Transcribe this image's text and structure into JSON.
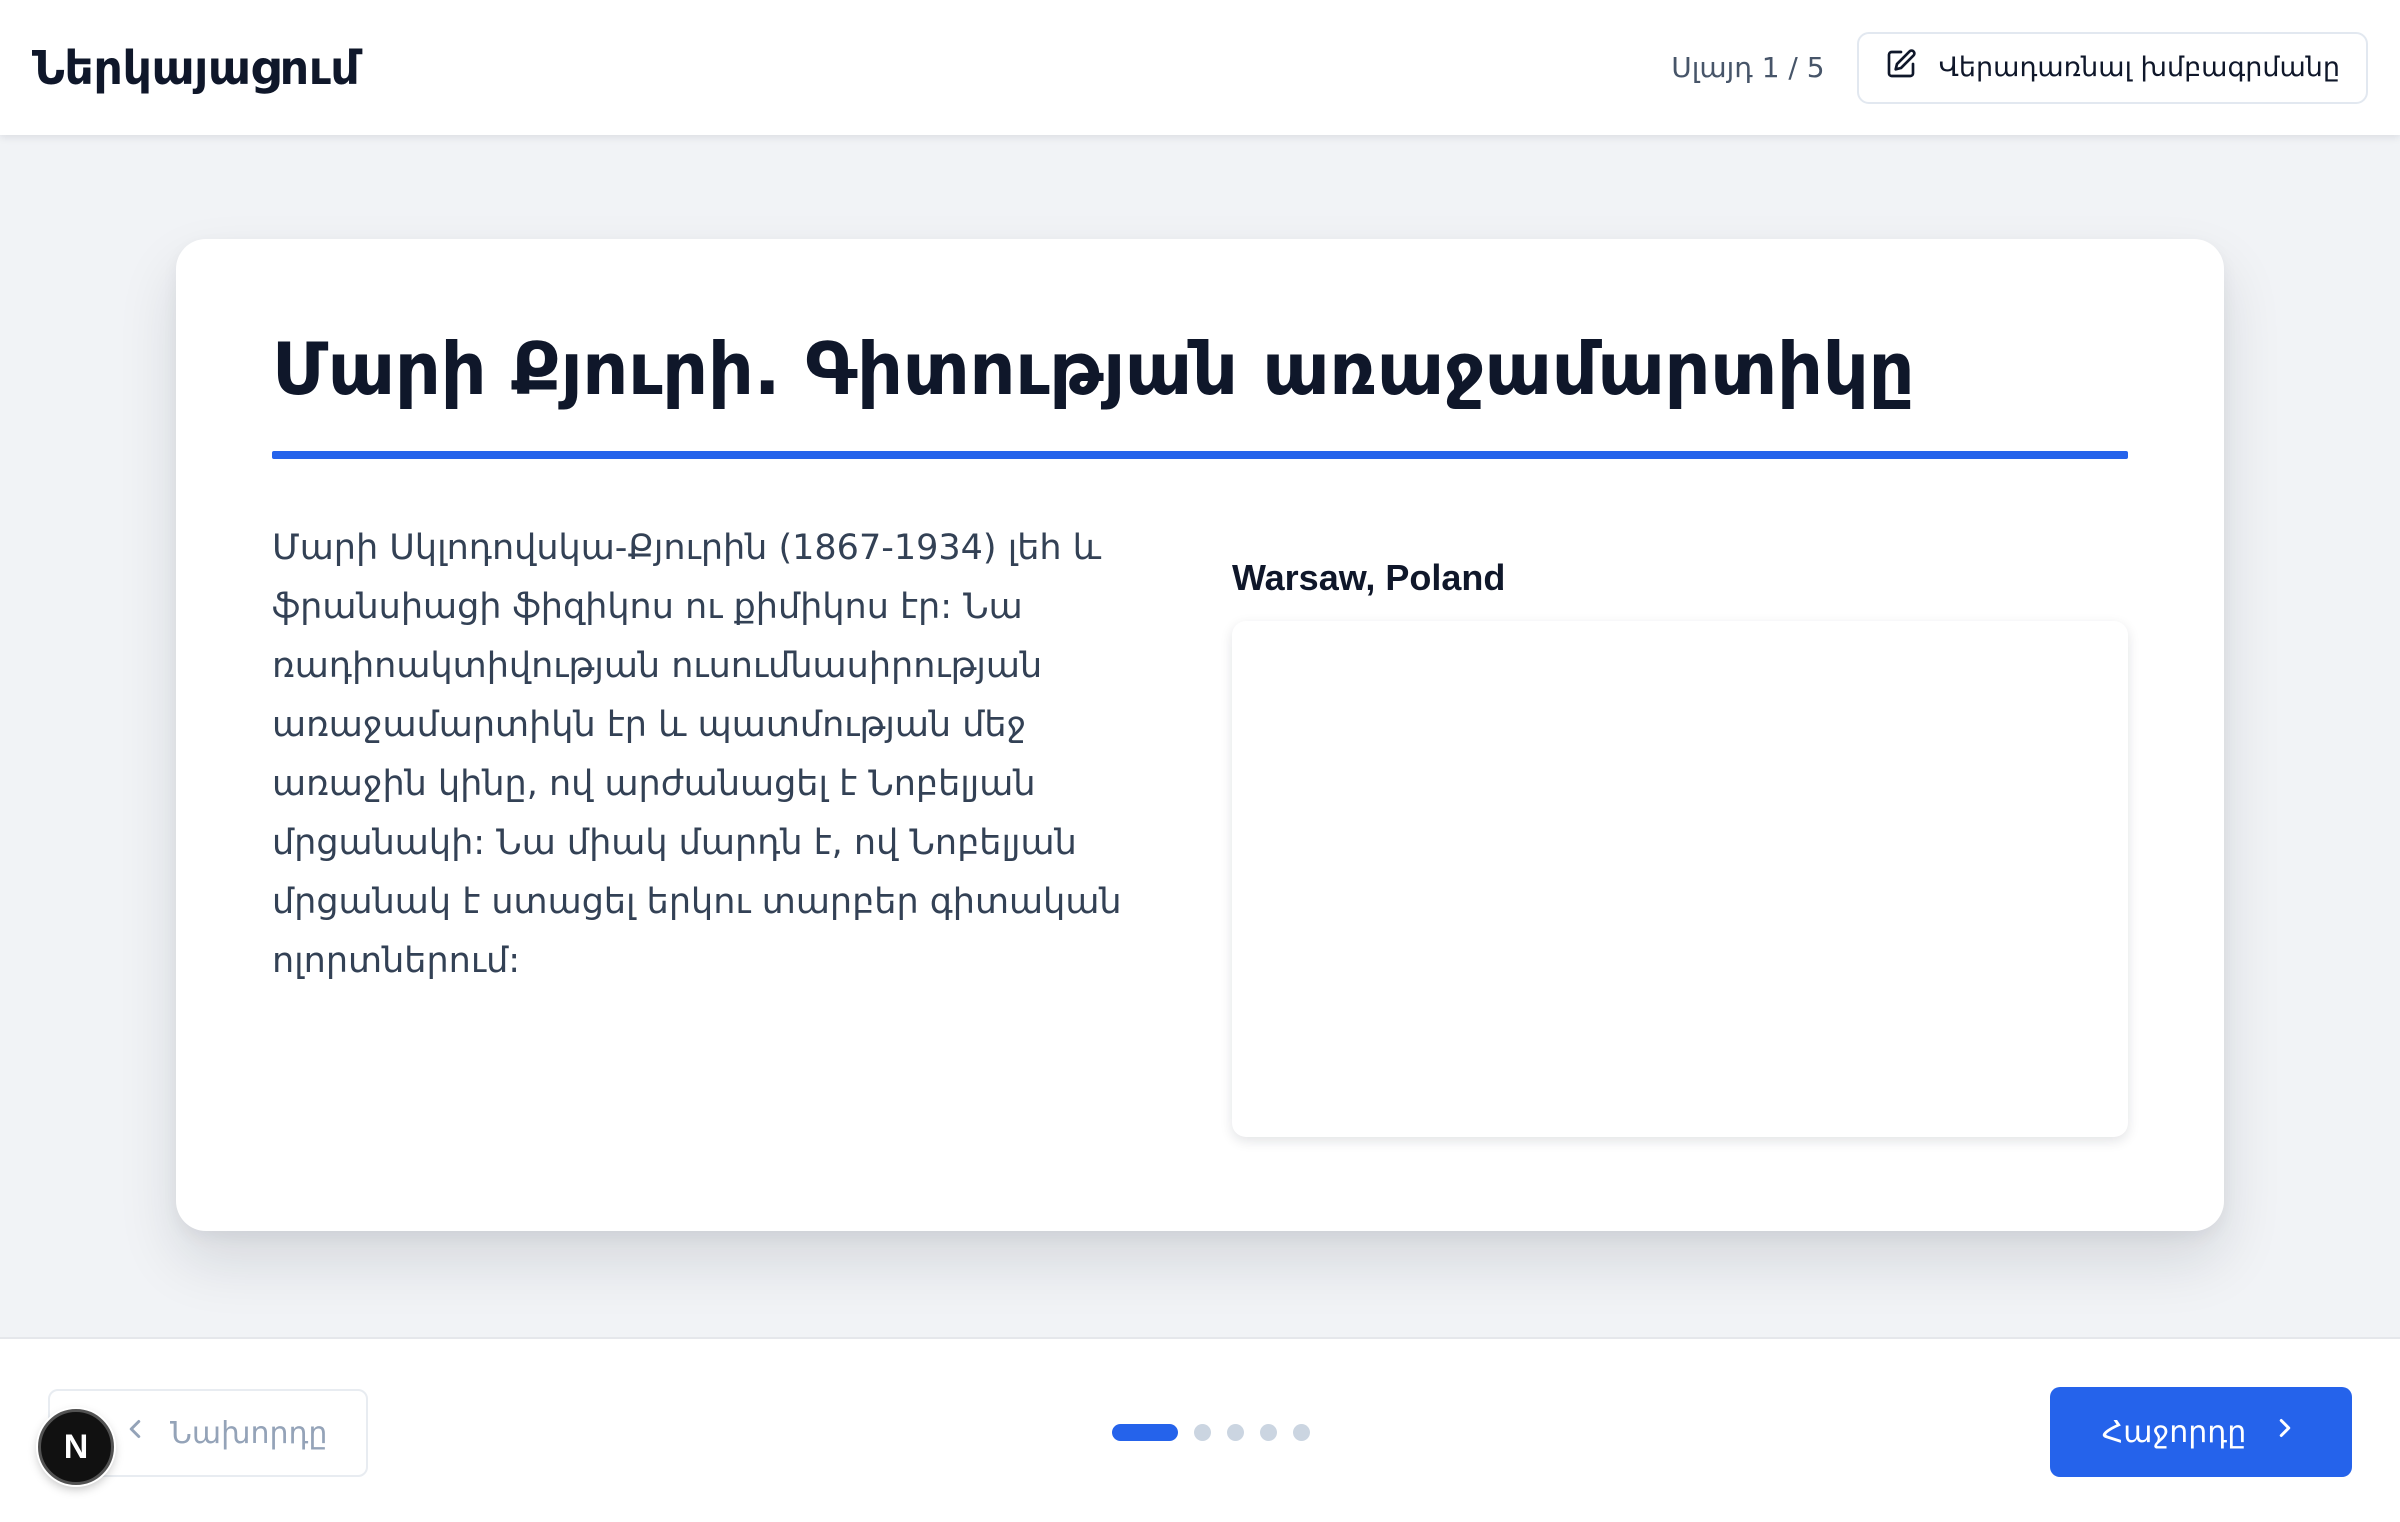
{
  "header": {
    "app_title": "Ներկայացում",
    "slide_counter": "Սլայդ 1 / 5",
    "back_to_editor_label": "Վերադառնալ խմբագրմանը"
  },
  "slide": {
    "title": "Մարի Քյուրի. Գիտության առաջամարտիկը",
    "body": "Մարի Սկլոդովսկա-Քյուրին (1867-1934) լեհ և ֆրանսիացի ֆիզիկոս ու քիմիկոս էր: Նա ռադիոակտիվության ուսումնասիրության առաջամարտիկն էր և պատմության մեջ առաջին կինը, ով արժանացել է Նոբելյան մրցանակի: Նա միակ մարդն է, ով Նոբելյան մրցանակ է ստացել երկու տարբեր գիտական ոլորտներում:",
    "map_caption": "Warsaw, Poland"
  },
  "footer": {
    "prev_label": "Նախորդը",
    "next_label": "Հաջորդը",
    "dots": [
      {
        "active": true
      },
      {
        "active": false
      },
      {
        "active": false
      },
      {
        "active": false
      },
      {
        "active": false
      }
    ],
    "logo_letter": "N"
  },
  "colors": {
    "accent": "#2563eb",
    "text": "#0f172a",
    "muted": "#94a3b8",
    "background": "#f1f3f6"
  },
  "icons": {
    "edit": "pencil-square-icon",
    "prev": "chevron-left-icon",
    "next": "chevron-right-icon"
  }
}
